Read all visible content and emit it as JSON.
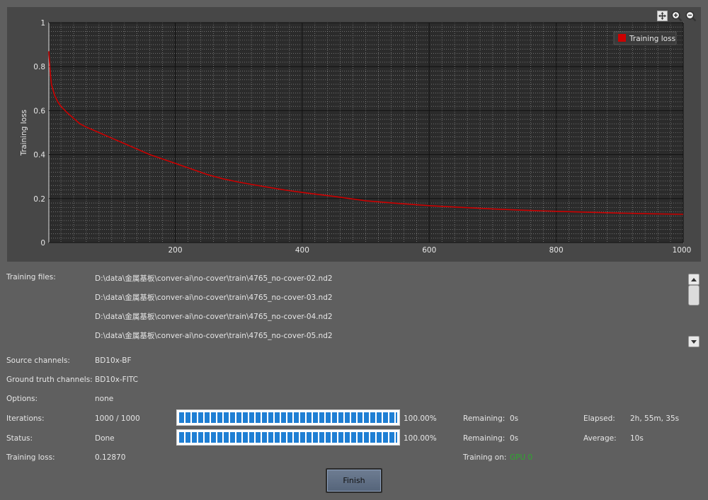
{
  "chart_data": {
    "type": "line",
    "ylabel": "Training loss",
    "xlabel": "",
    "xlim": [
      1,
      1000
    ],
    "ylim": [
      0,
      1
    ],
    "x_ticks": [
      "200",
      "400",
      "600",
      "800",
      "1000"
    ],
    "y_ticks": [
      "0",
      "0.2",
      "0.4",
      "0.6",
      "0.8",
      "1"
    ],
    "grid": true,
    "legend_placement": "top-right",
    "series": [
      {
        "name": "Training loss",
        "color": "#cc0000",
        "x": [
          1,
          3,
          5,
          10,
          15,
          20,
          30,
          40,
          50,
          60,
          80,
          100,
          120,
          140,
          160,
          180,
          200,
          225,
          250,
          275,
          300,
          325,
          350,
          375,
          400,
          425,
          450,
          475,
          500,
          550,
          600,
          650,
          700,
          750,
          800,
          850,
          900,
          950,
          1000
        ],
        "y": [
          0.87,
          0.78,
          0.72,
          0.67,
          0.64,
          0.62,
          0.59,
          0.565,
          0.54,
          0.525,
          0.5,
          0.475,
          0.45,
          0.425,
          0.4,
          0.38,
          0.36,
          0.335,
          0.31,
          0.29,
          0.275,
          0.262,
          0.25,
          0.238,
          0.228,
          0.219,
          0.21,
          0.2,
          0.19,
          0.178,
          0.168,
          0.16,
          0.153,
          0.147,
          0.142,
          0.138,
          0.134,
          0.131,
          0.1287
        ]
      }
    ]
  },
  "toolbar": {
    "fit_icon": "fit-view-icon",
    "zoom_in_icon": "zoom-in-icon",
    "zoom_out_icon": "zoom-out-icon"
  },
  "training_files": {
    "label": "Training files:",
    "files": [
      "D:\\data\\金属基板\\conver-ai\\no-cover\\train\\4765_no-cover-02.nd2",
      "D:\\data\\金属基板\\conver-ai\\no-cover\\train\\4765_no-cover-03.nd2",
      "D:\\data\\金属基板\\conver-ai\\no-cover\\train\\4765_no-cover-04.nd2",
      "D:\\data\\金属基板\\conver-ai\\no-cover\\train\\4765_no-cover-05.nd2"
    ]
  },
  "source_channels": {
    "label": "Source channels:",
    "value": "BD10x-BF"
  },
  "ground_truth_channels": {
    "label": "Ground truth channels:",
    "value": "BD10x-FITC"
  },
  "options": {
    "label": "Options:",
    "value": "none"
  },
  "iterations": {
    "label": "Iterations:",
    "value": "1000 / 1000",
    "progress": 1.0,
    "percent": "100.00%",
    "remaining_label": "Remaining:",
    "remaining": "0s",
    "elapsed_label": "Elapsed:",
    "elapsed": "2h, 55m, 35s"
  },
  "status": {
    "label": "Status:",
    "value": "Done",
    "progress": 1.0,
    "percent": "100.00%",
    "remaining_label": "Remaining:",
    "remaining": "0s",
    "average_label": "Average:",
    "average": "10s"
  },
  "training_loss": {
    "label": "Training loss:",
    "value": "0.12870"
  },
  "training_on": {
    "label": "Training on:",
    "value": "GPU 0",
    "color": "#2ea82e"
  },
  "finish_button": {
    "label": "Finish"
  }
}
